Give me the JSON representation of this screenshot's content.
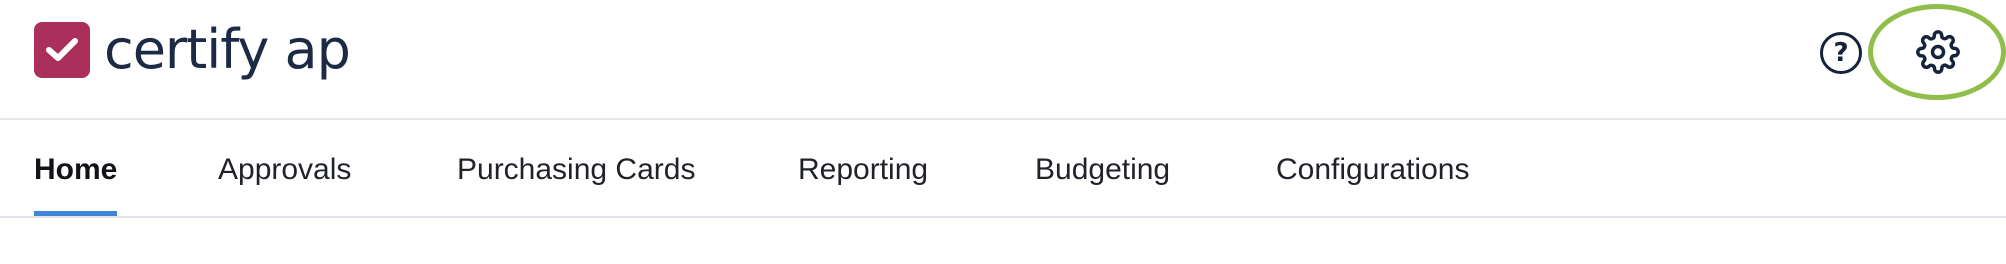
{
  "header": {
    "logo_text": "certify ap",
    "logo_icon": "checkmark-icon",
    "help_icon": "question-circle-icon",
    "settings_icon": "gear-icon"
  },
  "nav": {
    "tabs": [
      {
        "label": "Home",
        "active": true
      },
      {
        "label": "Approvals",
        "active": false
      },
      {
        "label": "Purchasing Cards",
        "active": false
      },
      {
        "label": "Reporting",
        "active": false
      },
      {
        "label": "Budgeting",
        "active": false
      },
      {
        "label": "Configurations",
        "active": false
      }
    ]
  },
  "colors": {
    "brand": "#ab2f5b",
    "logo_text": "#1c2a46",
    "accent": "#3f86d8",
    "highlight": "#8fbf4a"
  }
}
